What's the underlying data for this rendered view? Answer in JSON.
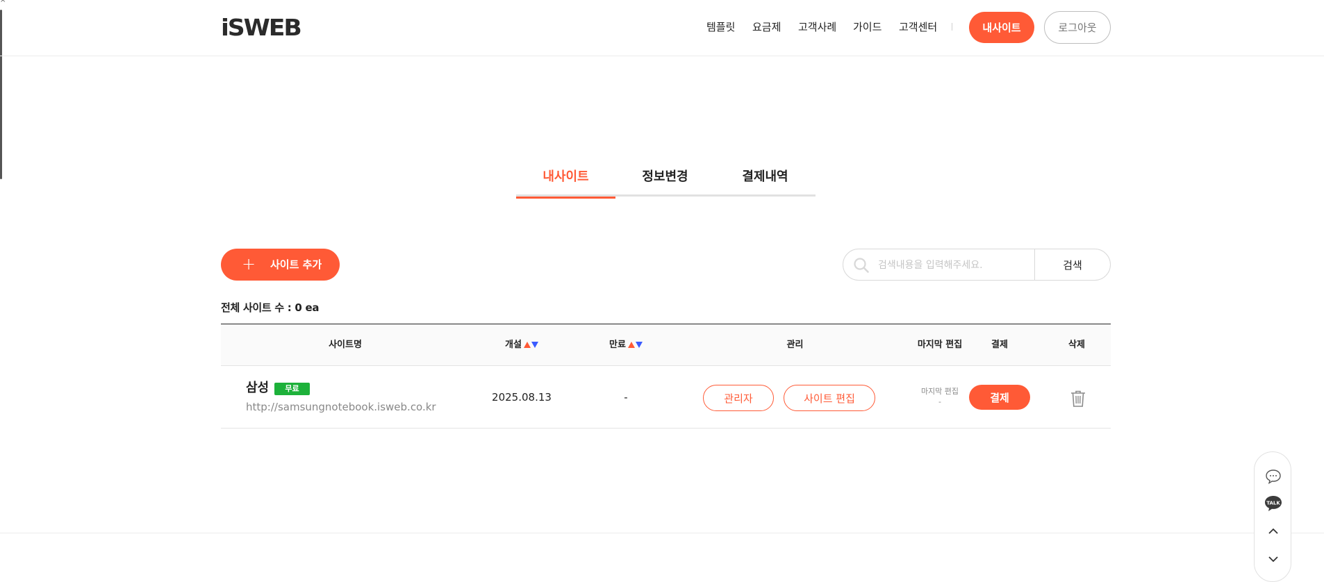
{
  "header": {
    "logo": "iSWEB",
    "nav": [
      "템플릿",
      "요금제",
      "고객사례",
      "가이드",
      "고객센터"
    ],
    "my_site_button": "내사이트",
    "logout_button": "로그아웃"
  },
  "tabs": [
    {
      "label": "내사이트",
      "active": true
    },
    {
      "label": "정보변경",
      "active": false
    },
    {
      "label": "결제내역",
      "active": false
    }
  ],
  "actions": {
    "add_site_label": "사이트 추가",
    "search_placeholder": "검색내용을 입력해주세요.",
    "search_button": "검색"
  },
  "total_sites": "전체 사이트 수 : 0 ea",
  "table": {
    "headers": {
      "site_name": "사이트명",
      "opened": "개설",
      "expires": "만료",
      "manage": "관리",
      "last_edit": "마지막 편집",
      "payment": "결제",
      "delete": "삭제"
    },
    "rows": [
      {
        "name": "삼성",
        "plan_badge": "무료",
        "url": "http://samsungnotebook.isweb.co.kr",
        "opened": "2025.08.13",
        "expires": "-",
        "admin_button": "관리자",
        "edit_button": "사이트 편집",
        "last_edit_label": "마지막 편집",
        "last_edit_value": "-",
        "pay_button": "결제"
      }
    ]
  },
  "colors": {
    "accent": "#ff5a36",
    "badge_green": "#1db13a",
    "sort_up": "#ff5a36",
    "sort_down": "#3b5bff"
  },
  "icons": [
    "plus-icon",
    "search-icon",
    "sort-arrows-icon",
    "trash-icon",
    "chat-icon",
    "kakao-talk-icon",
    "chevron-up-icon",
    "chevron-down-icon"
  ]
}
